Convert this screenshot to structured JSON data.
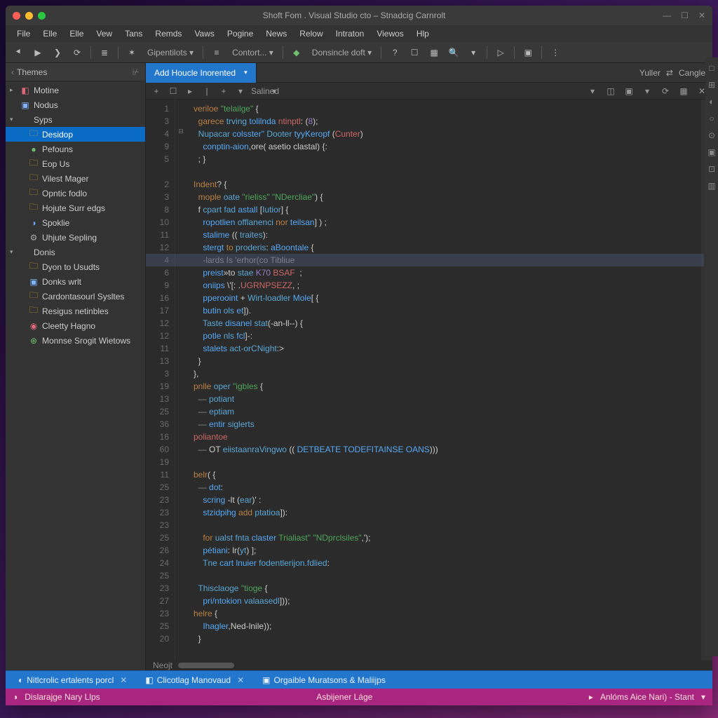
{
  "window": {
    "title": "Shoft Fom . Visual Studio cto – Stnadcig Carnrolt"
  },
  "menu": [
    "File",
    "Elle",
    "Elle",
    "Vew",
    "Tans",
    "Remds",
    "Vaws",
    "Pogine",
    "News",
    "Relow",
    "Intraton",
    "Viewos",
    "Hlp"
  ],
  "toolbar": {
    "items": [
      {
        "icon": "⯇",
        "name": "nav-back"
      },
      {
        "icon": "▶",
        "name": "nav-fwd"
      },
      {
        "icon": "❯",
        "name": "nav-next"
      },
      {
        "icon": "⟳",
        "name": "refresh"
      },
      {
        "sep": true
      },
      {
        "icon": "≣",
        "name": "list"
      },
      {
        "sep": true
      },
      {
        "icon": "✶",
        "name": "gipen-icon"
      },
      {
        "text": "Gipentilots",
        "drop": true
      },
      {
        "sep": true
      },
      {
        "icon": "≡",
        "name": "contort-icon"
      },
      {
        "text": "Contort...",
        "drop": true
      },
      {
        "sep": true
      },
      {
        "icon": "◆",
        "name": "don-icon",
        "color": "#6fbf6f"
      },
      {
        "text": "Donsincle doft",
        "drop": true
      },
      {
        "sep": true
      },
      {
        "icon": "?",
        "name": "help"
      },
      {
        "icon": "☐",
        "name": "box1"
      },
      {
        "icon": "▦",
        "name": "grid"
      },
      {
        "icon": "🔍",
        "name": "search"
      },
      {
        "drop": true,
        "name": "search-drop"
      },
      {
        "sep": true
      },
      {
        "icon": "▷",
        "name": "run"
      },
      {
        "sep": true
      },
      {
        "icon": "▣",
        "name": "panel"
      },
      {
        "sep": true
      },
      {
        "icon": "⋮",
        "name": "more"
      }
    ]
  },
  "sidebar": {
    "title": "Themes",
    "items": [
      {
        "d": 0,
        "icon": "◧",
        "cls": "ic-red",
        "label": "Motine",
        "arr": "▸"
      },
      {
        "d": 0,
        "icon": "▣",
        "cls": "ic-box",
        "label": "Nodus"
      },
      {
        "d": 0,
        "icon": "",
        "label": "Syps",
        "arr": "▾"
      },
      {
        "d": 1,
        "icon": "🗀",
        "cls": "ic-folder",
        "label": "Desidop",
        "sel": true
      },
      {
        "d": 1,
        "icon": "●",
        "cls": "ic-grn",
        "label": "Pefouns"
      },
      {
        "d": 1,
        "icon": "🗀",
        "cls": "ic-folder",
        "label": "Eop Us"
      },
      {
        "d": 1,
        "icon": "🗀",
        "cls": "ic-folder",
        "label": "Vilest Mager"
      },
      {
        "d": 1,
        "icon": "🗀",
        "cls": "ic-folder",
        "label": "Opntic fodlo"
      },
      {
        "d": 1,
        "icon": "🗀",
        "cls": "ic-folder",
        "label": "Hojute Surr edgs"
      },
      {
        "d": 1,
        "icon": "◑",
        "cls": "ic-blue",
        "label": "Spoklie"
      },
      {
        "d": 1,
        "icon": "⚙",
        "cls": "ic-gear",
        "label": "Uhjute Sepling"
      },
      {
        "d": 0,
        "icon": "",
        "label": "Donis",
        "arr": "▾"
      },
      {
        "d": 1,
        "icon": "🗀",
        "cls": "ic-folder",
        "label": "Dyon to Usudts"
      },
      {
        "d": 1,
        "icon": "▣",
        "cls": "ic-box",
        "label": "Donks wrlt"
      },
      {
        "d": 1,
        "icon": "🗀",
        "cls": "ic-folder",
        "label": "Cardontasourl Sysltes"
      },
      {
        "d": 1,
        "icon": "🗀",
        "cls": "ic-folder",
        "label": "Resigus netinbles"
      },
      {
        "d": 1,
        "icon": "◉",
        "cls": "ic-red",
        "label": "Cleetty Hagno"
      },
      {
        "d": 1,
        "icon": "⊕",
        "cls": "ic-grn",
        "label": "Monnse Srogit Wietows"
      }
    ]
  },
  "editor": {
    "tab": "Add Houcle Inorented",
    "tab_right": [
      "Yuller",
      "⇄",
      "Cangle"
    ],
    "sub": [
      "+",
      "☐",
      "▸",
      "|",
      "+",
      "▾",
      "Salined",
      "▾"
    ],
    "sub_right_icons": [
      "▾",
      "◫",
      "▣",
      "▾",
      "⟳",
      "▦",
      "✕"
    ],
    "gutter": [
      "1",
      "3",
      "4",
      "9",
      "5",
      "",
      "2",
      "3",
      "8",
      "10",
      "11",
      "12",
      "4",
      "6",
      "9",
      "16",
      "17",
      "12",
      "12",
      "11",
      "13",
      "3",
      "19",
      "13",
      "25",
      "36",
      "16",
      "60",
      "19",
      "11",
      "25",
      "23",
      "23",
      "23",
      "25",
      "26",
      "24",
      "25",
      "23",
      "27",
      "23",
      "25",
      "20"
    ],
    "fold": [
      "",
      "",
      "⊟",
      "",
      "",
      "",
      "",
      "",
      "",
      "",
      "",
      "",
      "",
      "",
      "",
      "",
      "",
      "",
      "",
      "",
      "",
      "",
      "",
      "",
      "",
      "",
      "",
      "",
      "",
      "",
      "",
      "",
      "",
      "",
      "",
      "",
      "",
      "",
      "",
      "",
      "",
      "",
      ""
    ],
    "lines": [
      [
        [
          "cl-kw",
          "veriloe "
        ],
        [
          "cl-str",
          "\"telailge\" "
        ],
        [
          "cl-op",
          "{"
        ]
      ],
      [
        [
          "cl-op",
          "  "
        ],
        [
          "cl-kw",
          "garece "
        ],
        [
          "cl-var",
          "trving "
        ],
        [
          "cl-fn",
          "tolilnda "
        ],
        [
          "cl-err",
          "ntinptl"
        ],
        [
          "cl-op",
          ": ("
        ],
        [
          "cl-num",
          "8"
        ],
        [
          "cl-op",
          ");"
        ]
      ],
      [
        [
          "cl-op",
          "  "
        ],
        [
          "cl-var",
          "Nupacar "
        ],
        [
          "cl-fn",
          "colsster\" "
        ],
        [
          "cl-var",
          "Dooter "
        ],
        [
          "cl-fn",
          "tyyKeropf "
        ],
        [
          "cl-op",
          "("
        ],
        [
          "cl-err",
          "Cunter"
        ],
        [
          "cl-op",
          ")"
        ]
      ],
      [
        [
          "cl-op",
          "    "
        ],
        [
          "cl-fn",
          "conptin-aion"
        ],
        [
          "cl-op",
          ",ore( asetio clastal) {:"
        ]
      ],
      [
        [
          "cl-op",
          "  ; }"
        ]
      ],
      [
        [
          "",
          ""
        ]
      ],
      [
        [
          "cl-kw",
          "Indent"
        ],
        [
          "cl-op",
          "? {"
        ]
      ],
      [
        [
          "cl-op",
          "  "
        ],
        [
          "cl-kw",
          "mople "
        ],
        [
          "cl-var",
          "oate "
        ],
        [
          "cl-str",
          "\"rieliss\" "
        ],
        [
          "cl-str",
          "\"NDercliae\""
        ],
        [
          "cl-op",
          ") {"
        ]
      ],
      [
        [
          "cl-op",
          "  f "
        ],
        [
          "cl-var",
          "cpart fad "
        ],
        [
          "cl-fn",
          "astall "
        ],
        [
          "cl-op",
          "["
        ],
        [
          "cl-var",
          "Iutior"
        ],
        [
          "cl-op",
          "] {"
        ]
      ],
      [
        [
          "cl-op",
          "    "
        ],
        [
          "cl-fn",
          "ropotlien "
        ],
        [
          "cl-var",
          "offlanenci "
        ],
        [
          "cl-kw",
          "nor "
        ],
        [
          "cl-fn",
          "teilsan"
        ],
        [
          "cl-op",
          "] ) ;"
        ]
      ],
      [
        [
          "cl-op",
          "    "
        ],
        [
          "cl-fn",
          "stalime "
        ],
        [
          "cl-op",
          "(( "
        ],
        [
          "cl-var",
          "traites"
        ],
        [
          "cl-op",
          "):"
        ]
      ],
      [
        [
          "cl-op",
          "    "
        ],
        [
          "cl-fn",
          "stergt "
        ],
        [
          "cl-kw",
          "to "
        ],
        [
          "cl-var",
          "proderis"
        ],
        [
          "cl-op",
          ": "
        ],
        [
          "cl-fn",
          "aBoontale "
        ],
        [
          "cl-op",
          "{"
        ]
      ],
      [
        [
          "cl-c",
          "    -lards Is 'erhor(co Tibliue"
        ]
      ],
      [
        [
          "cl-op",
          "    "
        ],
        [
          "cl-fn",
          "preist"
        ],
        [
          "cl-op",
          "»to "
        ],
        [
          "cl-var",
          "stae "
        ],
        [
          "cl-num",
          "K70 "
        ],
        [
          "cl-err",
          "BSAF "
        ],
        [
          "cl-op",
          " ;"
        ]
      ],
      [
        [
          "cl-op",
          "    "
        ],
        [
          "cl-fn",
          "oniips "
        ],
        [
          "cl-op",
          "\\'[: ."
        ],
        [
          "cl-err",
          "UGRNPSEZZ"
        ],
        [
          "cl-op",
          ", ;"
        ]
      ],
      [
        [
          "cl-op",
          "    "
        ],
        [
          "cl-fn",
          "pperooint "
        ],
        [
          "cl-op",
          "+ "
        ],
        [
          "cl-var",
          "Wirt-loadler "
        ],
        [
          "cl-fn",
          "Mole"
        ],
        [
          "cl-op",
          "[ {"
        ]
      ],
      [
        [
          "cl-op",
          "    "
        ],
        [
          "cl-fn",
          "butin "
        ],
        [
          "cl-var",
          "ols "
        ],
        [
          "cl-fn",
          "et"
        ],
        [
          "cl-op",
          "])."
        ]
      ],
      [
        [
          "cl-op",
          "    "
        ],
        [
          "cl-var",
          "Taste "
        ],
        [
          "cl-fn",
          "disanel "
        ],
        [
          "cl-var",
          "stat"
        ],
        [
          "cl-op",
          "(-an-ll--) {"
        ]
      ],
      [
        [
          "cl-op",
          "    "
        ],
        [
          "cl-fn",
          "potle "
        ],
        [
          "cl-var",
          "nls "
        ],
        [
          "cl-fn",
          "fcl"
        ],
        [
          "cl-op",
          "]-:"
        ]
      ],
      [
        [
          "cl-op",
          "    "
        ],
        [
          "cl-fn",
          "stalets "
        ],
        [
          "cl-var",
          "act-orCNight"
        ],
        [
          "cl-op",
          ":>"
        ]
      ],
      [
        [
          "cl-op",
          "  }"
        ]
      ],
      [
        [
          "cl-op",
          "},"
        ]
      ],
      [
        [
          "cl-kw",
          "pnlle "
        ],
        [
          "cl-var",
          "oper "
        ],
        [
          "cl-str",
          "\"igbles "
        ],
        [
          "cl-op",
          "{"
        ]
      ],
      [
        [
          "cl-c",
          "  — "
        ],
        [
          "cl-var",
          "potiant"
        ]
      ],
      [
        [
          "cl-c",
          "  — "
        ],
        [
          "cl-var",
          "eptiam"
        ]
      ],
      [
        [
          "cl-c",
          "  — "
        ],
        [
          "cl-fn",
          "entir "
        ],
        [
          "cl-var",
          "siglerts"
        ]
      ],
      [
        [
          "cl-err",
          "poliantoe"
        ]
      ],
      [
        [
          "cl-c",
          "  — "
        ],
        [
          "cl-op",
          "OT "
        ],
        [
          "cl-var",
          "eiistaanraVingwo "
        ],
        [
          "cl-op",
          "(( "
        ],
        [
          "cl-fn",
          "DETBEATE TODEFITAINSE OANS"
        ],
        [
          "cl-op",
          ")))"
        ]
      ],
      [
        [
          "",
          ""
        ]
      ],
      [
        [
          "cl-kw",
          "belr"
        ],
        [
          "cl-op",
          "( {"
        ]
      ],
      [
        [
          "cl-c",
          "  — "
        ],
        [
          "cl-fn",
          "dot"
        ],
        [
          "cl-op",
          ":"
        ]
      ],
      [
        [
          "cl-op",
          "    "
        ],
        [
          "cl-fn",
          "scring "
        ],
        [
          "cl-op",
          "-lt ("
        ],
        [
          "cl-var",
          "ear"
        ],
        [
          "cl-op",
          ")' :"
        ]
      ],
      [
        [
          "cl-op",
          "    "
        ],
        [
          "cl-fn",
          "stzidpihg "
        ],
        [
          "cl-kw",
          "add "
        ],
        [
          "cl-var",
          "ptatioa"
        ],
        [
          "cl-op",
          "]):"
        ]
      ],
      [
        [
          "",
          ""
        ]
      ],
      [
        [
          "cl-op",
          "    "
        ],
        [
          "cl-kw",
          "for "
        ],
        [
          "cl-var",
          "ualst fnta "
        ],
        [
          "cl-fn",
          "claster "
        ],
        [
          "cl-str",
          "Trialiast\" "
        ],
        [
          "cl-str",
          "\"NDprclsiles\""
        ],
        [
          "cl-op",
          ",');"
        ]
      ],
      [
        [
          "cl-op",
          "    "
        ],
        [
          "cl-fn",
          "pétiani"
        ],
        [
          "cl-op",
          ": lr("
        ],
        [
          "cl-var",
          "yt"
        ],
        [
          "cl-op",
          ") ];"
        ]
      ],
      [
        [
          "cl-op",
          "    "
        ],
        [
          "cl-var",
          "Tne "
        ],
        [
          "cl-fn",
          "cart lnuier "
        ],
        [
          "cl-var",
          "fodentlerijon.fdlied"
        ],
        [
          "cl-op",
          ":"
        ]
      ],
      [
        [
          "",
          ""
        ]
      ],
      [
        [
          "cl-op",
          "  "
        ],
        [
          "cl-var",
          "Thisclaoge "
        ],
        [
          "cl-str",
          "\"tioge "
        ],
        [
          "cl-op",
          "{"
        ]
      ],
      [
        [
          "cl-op",
          "    "
        ],
        [
          "cl-fn",
          "pri/ntokion "
        ],
        [
          "cl-var",
          "valaasedl"
        ],
        [
          "cl-op",
          "]));"
        ]
      ],
      [
        [
          "cl-kw",
          "helre "
        ],
        [
          "cl-op",
          "{"
        ]
      ],
      [
        [
          "cl-op",
          "    "
        ],
        [
          "cl-fn",
          "Ihagler"
        ],
        [
          "cl-op",
          ",Ned-lnile));"
        ]
      ],
      [
        [
          "cl-op",
          "  }"
        ]
      ]
    ],
    "hscroll_label": "Neojt"
  },
  "right_icons": [
    "□",
    "⊞",
    "◐",
    "○",
    "⊙",
    "▣",
    "⊡",
    "▥"
  ],
  "bottom": [
    {
      "icon": "◐",
      "label": "Nitlcrolic ertalents porcl",
      "x": true
    },
    {
      "icon": "◧",
      "label": "Clicotlag Manovaud",
      "x": true
    },
    {
      "icon": "▣",
      "label": "Orgaible Muratsons & Maliijps"
    }
  ],
  "status": {
    "left_icon": "◑",
    "left": "Dislarajge Nary Llps",
    "mid": "Asbijener Láge",
    "right_icon": "▸",
    "right": "Anlóms Aice Nari) - Stant"
  }
}
